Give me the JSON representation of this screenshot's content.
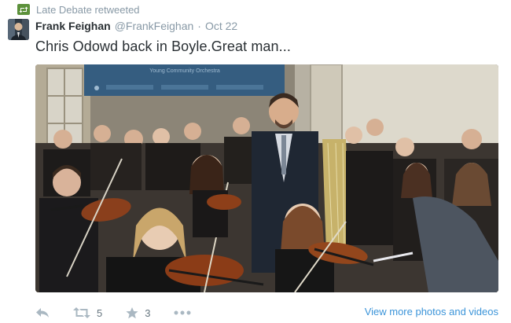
{
  "tweet": {
    "retweet_context": "Late Debate retweeted",
    "author": {
      "full_name": "Frank Feighan",
      "handle": "@FrankFeighan",
      "separator": "·"
    },
    "timestamp": "Oct 22",
    "text": "Chris Odowd back in Boyle.Great man...",
    "media": {
      "banner_text": "Young Community Orchestra",
      "description_icon": "photo"
    },
    "actions": {
      "reply_icon": "reply-icon",
      "retweet_icon": "retweet-icon",
      "retweet_count": "5",
      "favorite_icon": "star-icon",
      "favorite_count": "3",
      "more_icon": "more-dots-icon"
    },
    "view_more_label": "View more photos and videos"
  },
  "colors": {
    "retweet_green": "#5c913b",
    "link_blue": "#3b94d9",
    "muted_gray": "#8899a6",
    "text_dark": "#292f33"
  }
}
